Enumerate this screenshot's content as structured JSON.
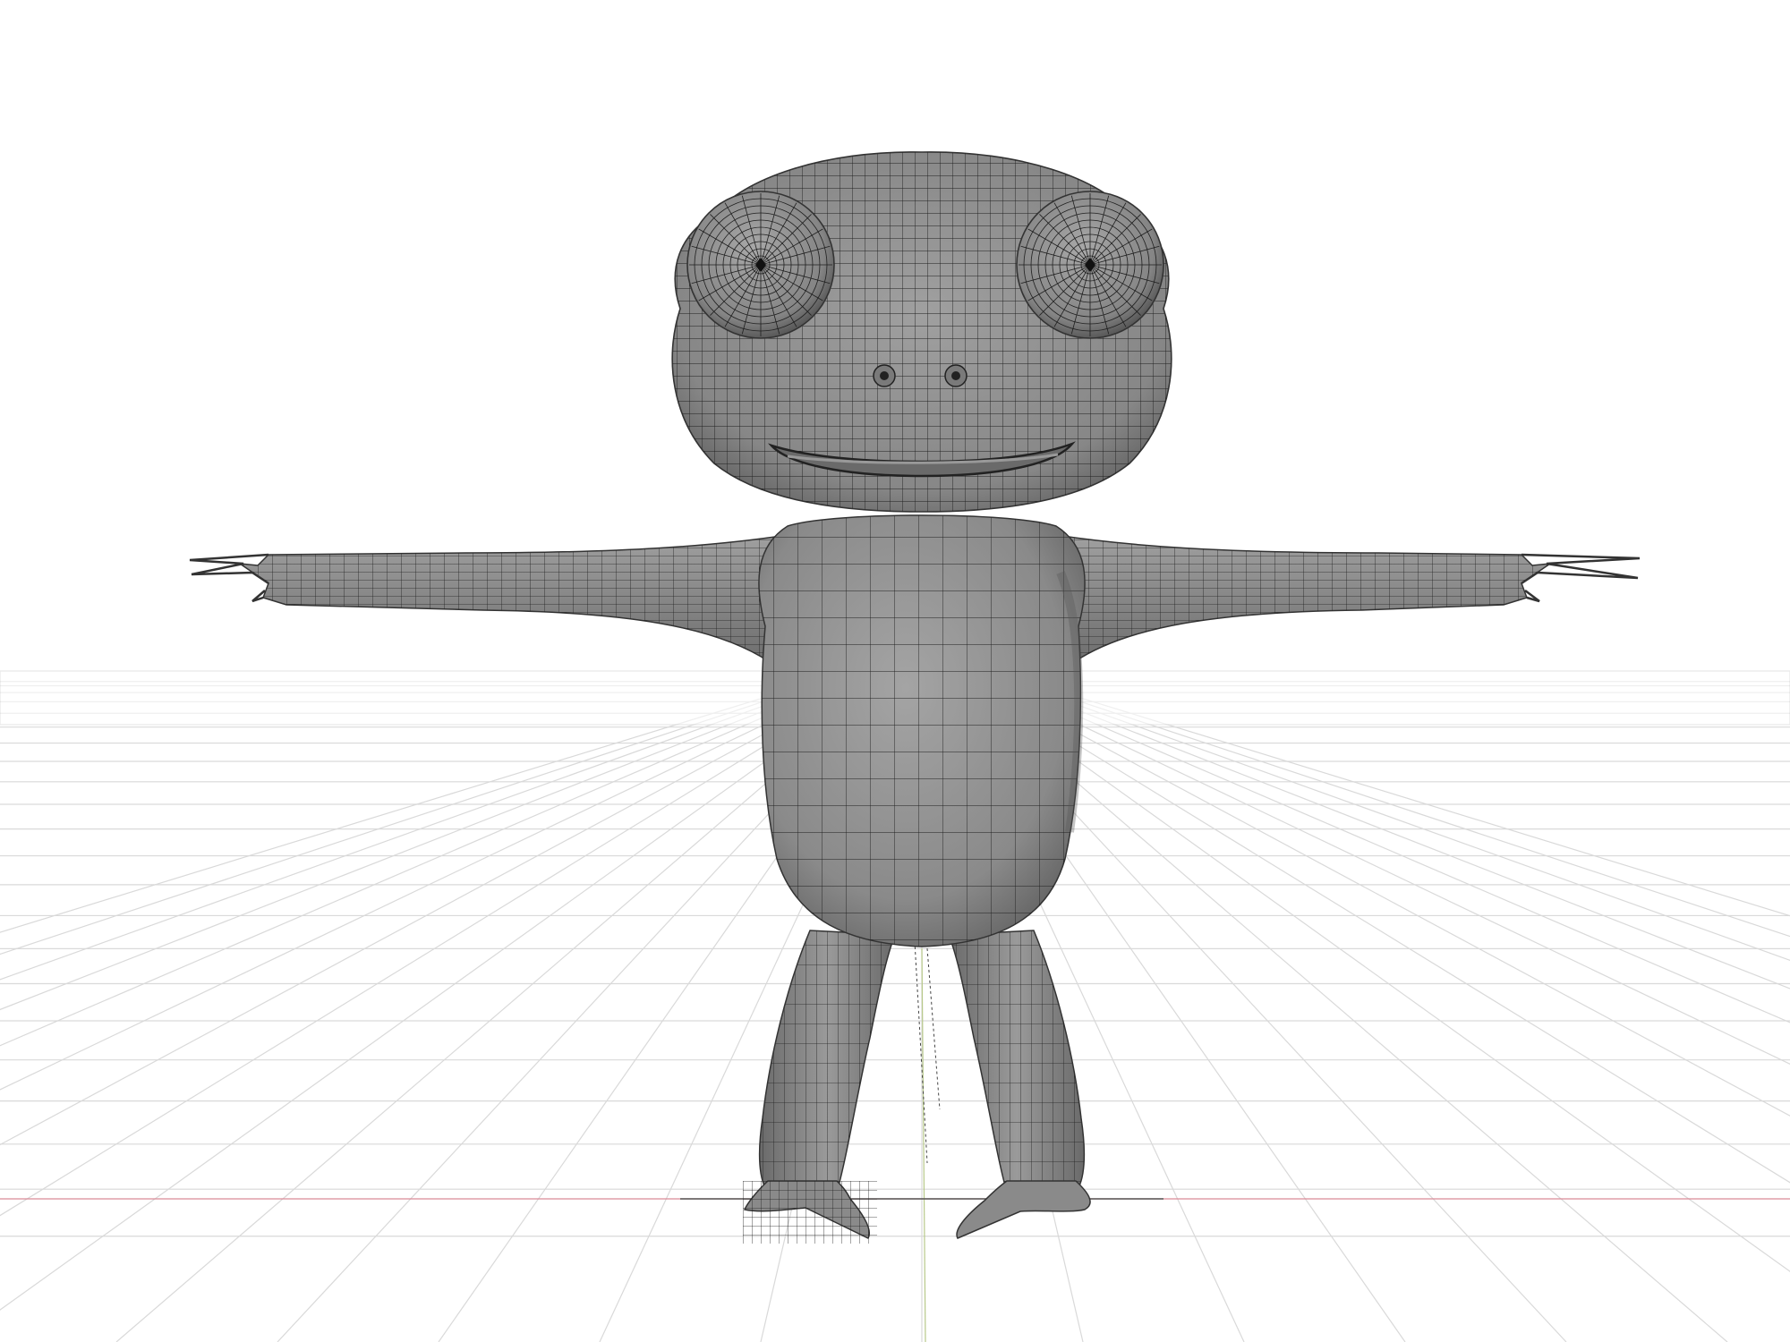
{
  "viewport": {
    "background_color": "#ffffff",
    "grid_color": "#d9d9d9",
    "x_axis_color": "#d98a98",
    "y_axis_color": "#b8c98a",
    "model_fill": "#8e8e8e",
    "model_shade": "#6a6a6a",
    "wire_color": "#1f1f1f",
    "grid_visible": true,
    "axes_visible": true
  },
  "model": {
    "icon": "frog-character-mesh",
    "shading": "solid-with-wireframe",
    "pose": "T-pose"
  }
}
